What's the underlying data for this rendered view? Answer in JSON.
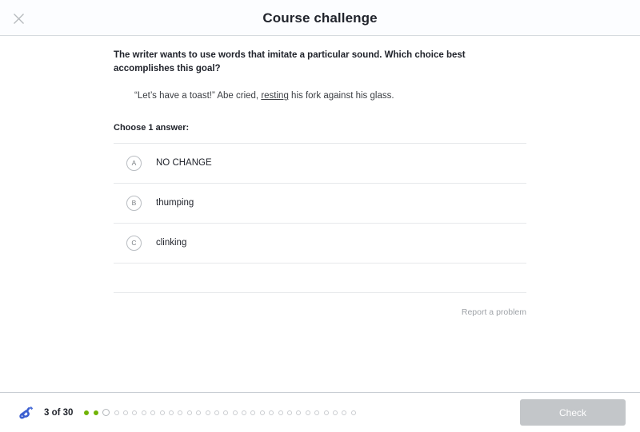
{
  "header": {
    "title": "Course challenge",
    "close_icon": "close-icon"
  },
  "question": {
    "prompt": "The writer wants to use words that imitate a particular sound. Which choice best accomplishes this goal?",
    "passage_before": "“Let’s have a toast!” Abe cried, ",
    "passage_underlined": "resting",
    "passage_after": " his fork against his glass.",
    "choose_label": "Choose 1 answer:",
    "options": [
      {
        "letter": "A",
        "text": "NO CHANGE"
      },
      {
        "letter": "B",
        "text": "thumping"
      },
      {
        "letter": "C",
        "text": "clinking"
      }
    ],
    "report_label": "Report a problem"
  },
  "footer": {
    "progress_icon": "pencil-icon",
    "progress_text": "3 of 30",
    "current_index": 3,
    "total": 30,
    "completed": 2,
    "check_label": "Check"
  },
  "colors": {
    "accent_green": "#71b307",
    "icon_blue": "#3b5ed0",
    "disabled_gray": "#c3c6c9",
    "divider": "#e7e9eb",
    "text": "#21242c",
    "muted_text": "#9fa3a8"
  }
}
